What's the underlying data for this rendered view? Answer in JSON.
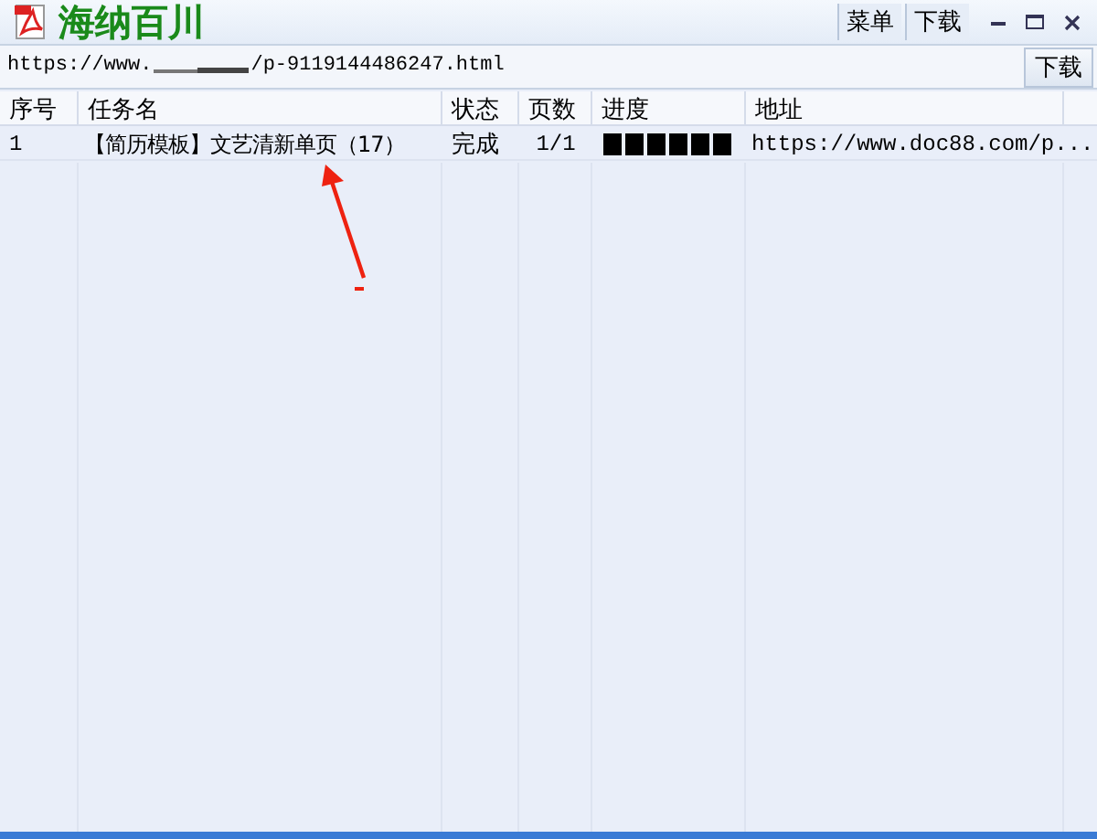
{
  "window": {
    "title": "海纳百川",
    "buttons": [
      "菜单",
      "下载"
    ]
  },
  "url_bar": {
    "prefix": "https://www.",
    "suffix": "/p-9119144486247.html",
    "button": "下载"
  },
  "table": {
    "columns": [
      "序号",
      "任务名",
      "状态",
      "页数",
      "进度",
      "地址"
    ],
    "rows": [
      {
        "index": "1",
        "name": "【简历模板】文艺清新单页（17）",
        "status": "完成",
        "pages": "1/1",
        "address": "https://www.doc88.com/p..."
      }
    ]
  }
}
